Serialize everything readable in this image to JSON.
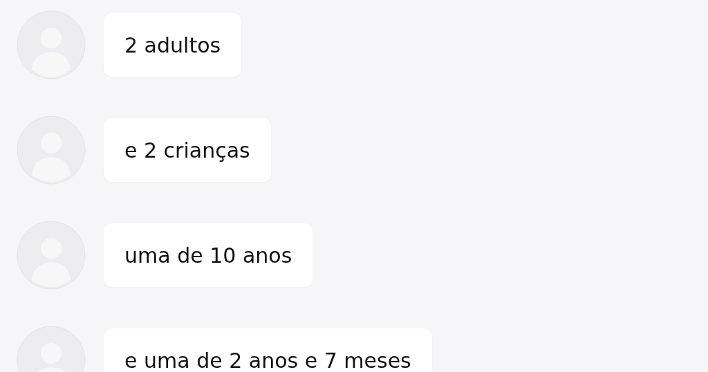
{
  "messages": [
    {
      "text": "2 adultos"
    },
    {
      "text": "e 2 crianças"
    },
    {
      "text": "uma de 10 anos"
    },
    {
      "text": "e uma de 2 anos e 7 meses"
    }
  ]
}
